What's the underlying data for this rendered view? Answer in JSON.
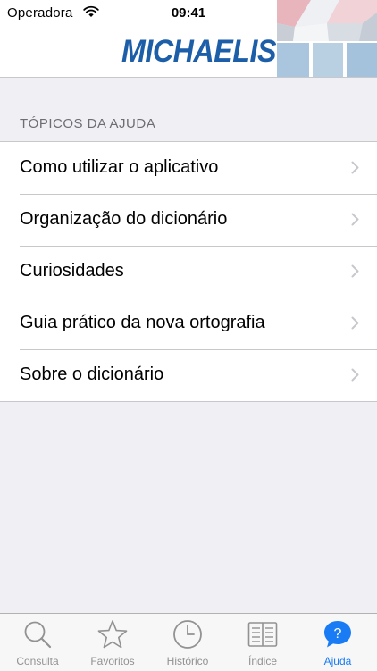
{
  "status_bar": {
    "carrier": "Operadora",
    "time": "09:41"
  },
  "header": {
    "logo": "MICHAELIS"
  },
  "section": {
    "title": "TÓPICOS DA AJUDA"
  },
  "items": [
    {
      "label": "Como utilizar o aplicativo"
    },
    {
      "label": "Organização do dicionário"
    },
    {
      "label": "Curiosidades"
    },
    {
      "label": "Guia prático da nova ortografia"
    },
    {
      "label": "Sobre o dicionário"
    }
  ],
  "tabs": [
    {
      "label": "Consulta",
      "icon": "search-icon"
    },
    {
      "label": "Favoritos",
      "icon": "star-icon"
    },
    {
      "label": "Histórico",
      "icon": "clock-icon"
    },
    {
      "label": "Índice",
      "icon": "book-icon"
    },
    {
      "label": "Ajuda",
      "icon": "help-icon",
      "active": true
    }
  ],
  "colors": {
    "brand": "#1c5ea8",
    "accent": "#1a7cf4",
    "tab_inactive": "#929292",
    "background": "#efeff4"
  }
}
